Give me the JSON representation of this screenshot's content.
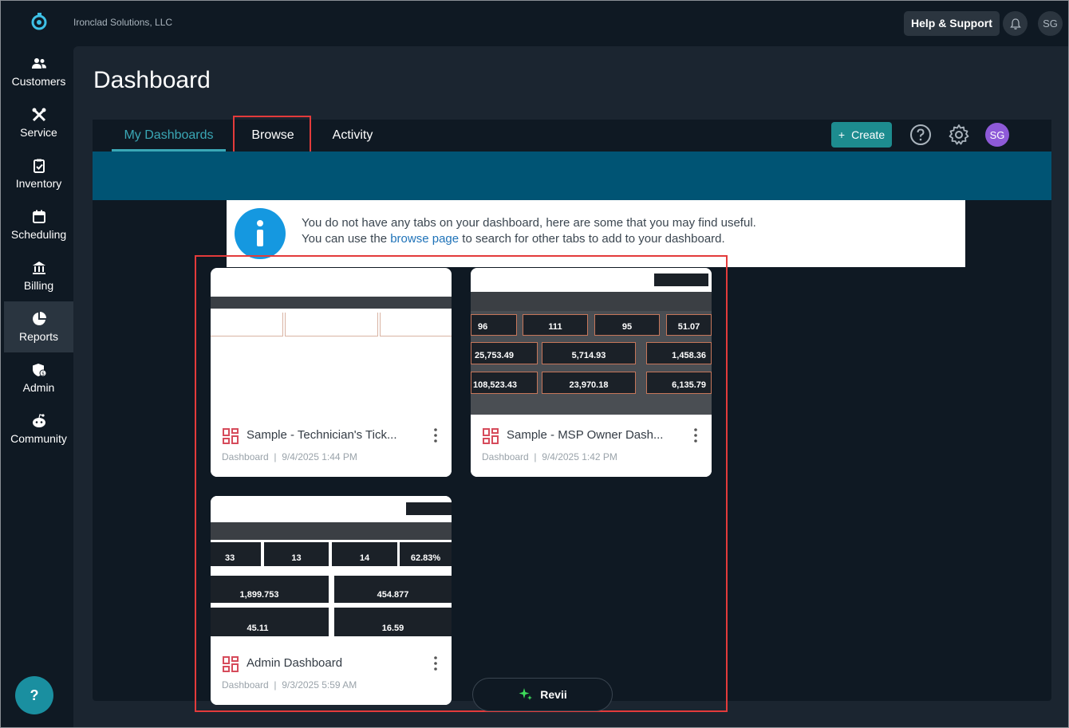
{
  "topbar": {
    "company": "Ironclad Solutions, LLC",
    "help_label": "Help & Support",
    "user_initials": "SG"
  },
  "sidebar": {
    "items": [
      {
        "label": "Customers",
        "icon": "users-icon"
      },
      {
        "label": "Service",
        "icon": "tools-icon"
      },
      {
        "label": "Inventory",
        "icon": "clipboard-check-icon"
      },
      {
        "label": "Scheduling",
        "icon": "calendar-icon"
      },
      {
        "label": "Billing",
        "icon": "bank-icon"
      },
      {
        "label": "Reports",
        "icon": "pie-chart-icon",
        "active": true
      },
      {
        "label": "Admin",
        "icon": "shield-dollar-icon"
      },
      {
        "label": "Community",
        "icon": "community-icon"
      }
    ],
    "help_fab": "?"
  },
  "page": {
    "title": "Dashboard",
    "tabs": [
      {
        "label": "My Dashboards",
        "active": true
      },
      {
        "label": "Browse"
      },
      {
        "label": "Activity"
      }
    ],
    "create_label": "Create",
    "create_plus": "+",
    "user_initials": "SG"
  },
  "info": {
    "line1": "You do not have any tabs on your dashboard, here are some that you may find useful.",
    "line2_prefix": "You can use the ",
    "line2_link": "browse page",
    "line2_suffix": " to search for other tabs to add to your dashboard."
  },
  "dashboards": [
    {
      "title": "Sample - Technician's Tick...",
      "type": "Dashboard",
      "date": "9/4/2025 1:44 PM"
    },
    {
      "title": "Sample - MSP Owner Dash...",
      "type": "Dashboard",
      "date": "9/4/2025 1:42 PM",
      "stats_row1": [
        "96",
        "111",
        "95",
        "51.07"
      ],
      "stats_row2": [
        "25,753.49",
        "5,714.93",
        "1,458.36"
      ],
      "stats_row3": [
        "108,523.43",
        "23,970.18",
        "6,135.79"
      ]
    },
    {
      "title": "Admin Dashboard",
      "type": "Dashboard",
      "date": "9/3/2025 5:59 AM",
      "stats_row1": [
        "33",
        "13",
        "14",
        "62.83%"
      ],
      "stats_row2": [
        "1,899.753",
        "454.877"
      ],
      "stats_row3": [
        "45.11",
        "16.59"
      ]
    }
  ],
  "meta_separator": "|",
  "revii_label": "Revii",
  "colors": {
    "accent": "#3aa7b5",
    "create": "#1d8c8f",
    "teal_band": "#005474",
    "highlight": "#e33b3b",
    "info": "#1598e0",
    "avatar": "#8e5ad8"
  }
}
